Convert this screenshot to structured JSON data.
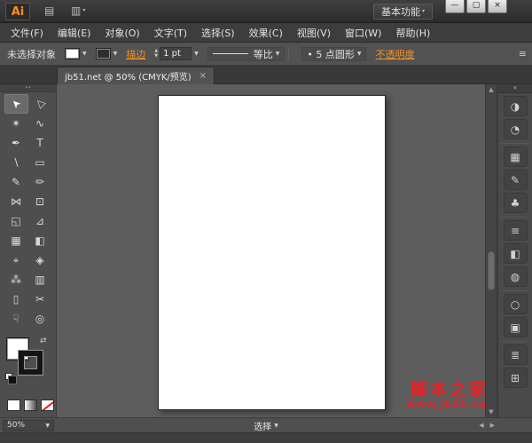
{
  "titlebar": {
    "logo": "Ai",
    "workspace": "基本功能"
  },
  "icons": {
    "bridge": "▤",
    "arrange_documents": "▥",
    "caret_down": "▼",
    "caret_tiny": "▾",
    "minimize": "—",
    "restore": "▢",
    "close": "×",
    "tab_close": "×",
    "stepper_up": "▲",
    "stepper_down": "▼",
    "swap": "⇄",
    "panel_menu": "≡",
    "collapse": "«",
    "scroll_up": "▲",
    "scroll_down": "▼",
    "scroll_left": "◀",
    "scroll_right": "▶",
    "grip_dots": "∙∙"
  },
  "menubar": {
    "items": [
      {
        "label": "文件(F)"
      },
      {
        "label": "编辑(E)"
      },
      {
        "label": "对象(O)"
      },
      {
        "label": "文字(T)"
      },
      {
        "label": "选择(S)"
      },
      {
        "label": "效果(C)"
      },
      {
        "label": "视图(V)"
      },
      {
        "label": "窗口(W)"
      },
      {
        "label": "帮助(H)"
      }
    ]
  },
  "controlbar": {
    "no_selection": "未选择对象",
    "stroke_link": "描边",
    "stroke_weight": "1 pt",
    "profile_label": "等比",
    "brush_label": "• 5 点圆形",
    "opacity_link": "不透明度"
  },
  "tab": {
    "title": "jb51.net @ 50% (CMYK/预览)"
  },
  "tools": [
    {
      "name": "selection",
      "glyph": "➤"
    },
    {
      "name": "direct-selection",
      "glyph": "▷"
    },
    {
      "name": "magic-wand",
      "glyph": "✶"
    },
    {
      "name": "lasso",
      "glyph": "∿"
    },
    {
      "name": "pen",
      "glyph": "✒"
    },
    {
      "name": "type",
      "glyph": "T"
    },
    {
      "name": "line-segment",
      "glyph": "∖"
    },
    {
      "name": "rectangle",
      "glyph": "▭"
    },
    {
      "name": "paintbrush",
      "glyph": "✎"
    },
    {
      "name": "pencil",
      "glyph": "✏"
    },
    {
      "name": "width",
      "glyph": "⋈"
    },
    {
      "name": "free-transform",
      "glyph": "⊡"
    },
    {
      "name": "shape-builder",
      "glyph": "◱"
    },
    {
      "name": "perspective-grid",
      "glyph": "⊿"
    },
    {
      "name": "mesh",
      "glyph": "▦"
    },
    {
      "name": "gradient",
      "glyph": "◧"
    },
    {
      "name": "eyedropper",
      "glyph": "⌖"
    },
    {
      "name": "blend",
      "glyph": "◈"
    },
    {
      "name": "symbol-sprayer",
      "glyph": "⁂"
    },
    {
      "name": "column-graph",
      "glyph": "▥"
    },
    {
      "name": "artboard",
      "glyph": "▯"
    },
    {
      "name": "slice",
      "glyph": "✂"
    },
    {
      "name": "hand",
      "glyph": "☟"
    },
    {
      "name": "zoom",
      "glyph": "◎"
    }
  ],
  "panels": [
    {
      "name": "color",
      "glyph": "◑"
    },
    {
      "name": "color-guide",
      "glyph": "◔"
    },
    {
      "name": "swatches",
      "glyph": "▦"
    },
    {
      "name": "brushes",
      "glyph": "✎"
    },
    {
      "name": "symbols",
      "glyph": "♣"
    },
    {
      "name": "stroke",
      "glyph": "≡"
    },
    {
      "name": "gradient",
      "glyph": "◧"
    },
    {
      "name": "transparency",
      "glyph": "◍"
    },
    {
      "name": "appearance",
      "glyph": "○"
    },
    {
      "name": "graphic-styles",
      "glyph": "▣"
    },
    {
      "name": "layers",
      "glyph": "≣"
    },
    {
      "name": "artboards",
      "glyph": "⊞"
    }
  ],
  "statusbar": {
    "zoom": "50%",
    "status": "选择"
  },
  "watermark": {
    "line1": "脚本之家",
    "line2": "www.jb51.net"
  },
  "colors": {
    "accent_orange": "#f7931e",
    "watermark_red": "#f01d23",
    "ui_dark": "#3d3d3d",
    "ui_mid": "#525252",
    "canvas_gray": "#5d5d5d"
  }
}
